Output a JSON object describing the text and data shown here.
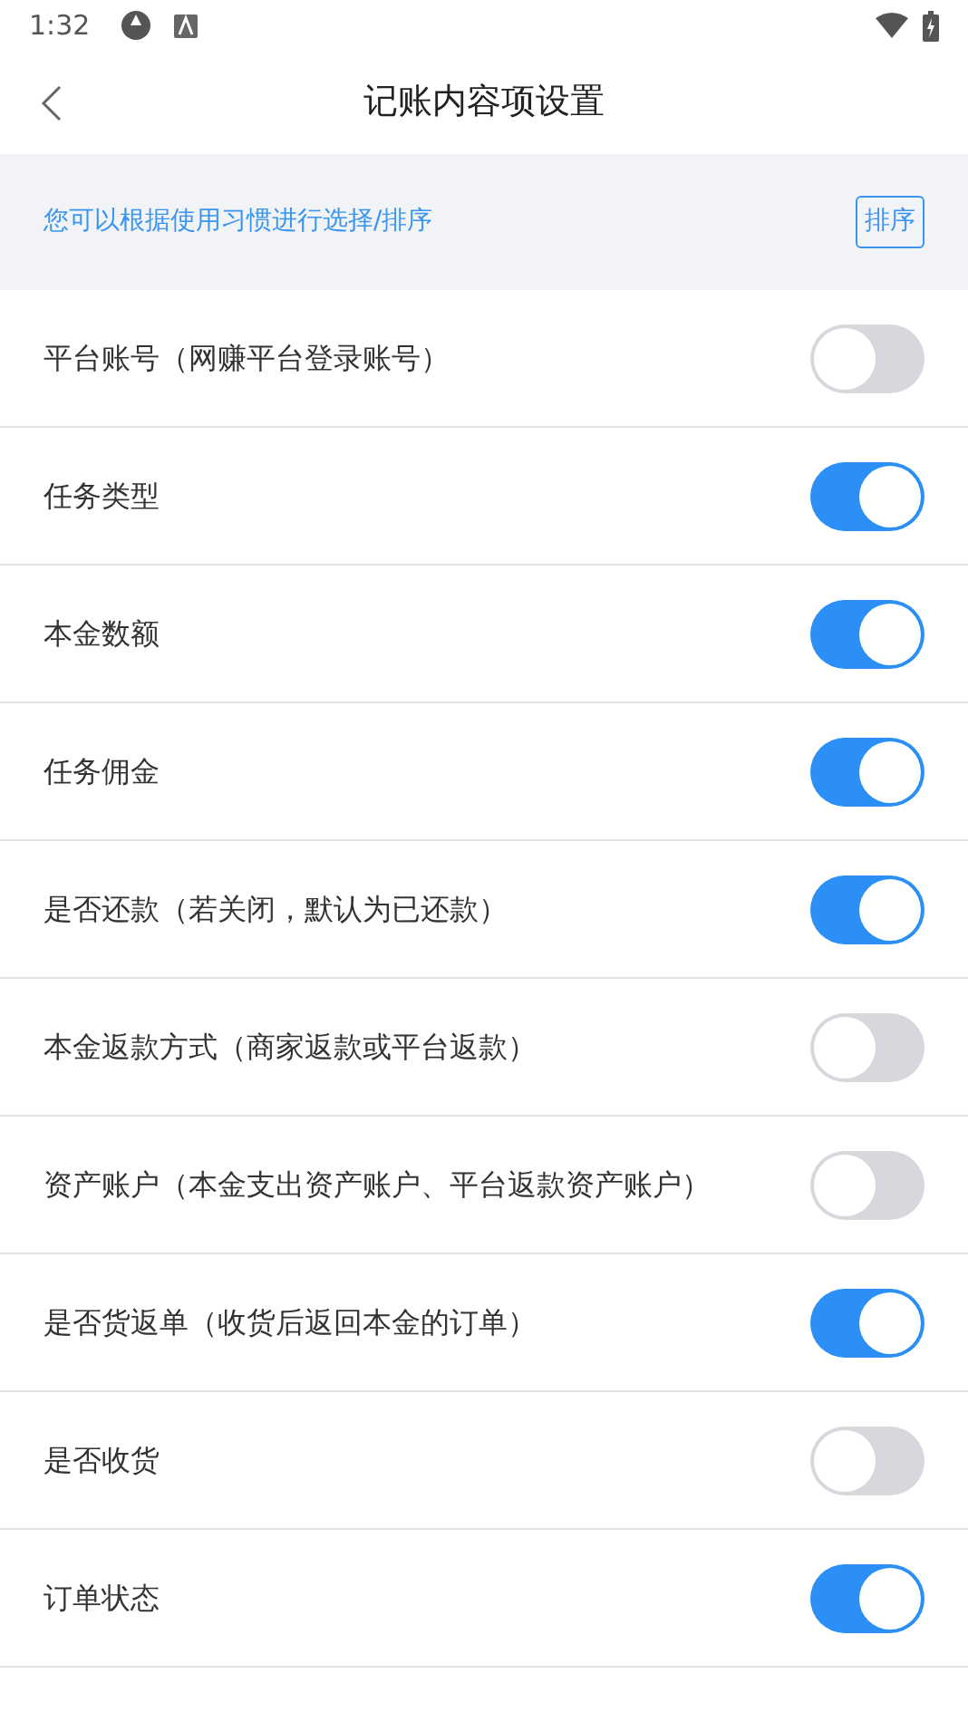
{
  "status_bar": {
    "time": "1:32"
  },
  "header": {
    "title": "记账内容项设置"
  },
  "banner": {
    "text": "您可以根据使用习惯进行选择/排序",
    "button": "排序"
  },
  "items": [
    {
      "label": "平台账号（网赚平台登录账号）",
      "on": false
    },
    {
      "label": "任务类型",
      "on": true
    },
    {
      "label": "本金数额",
      "on": true
    },
    {
      "label": "任务佣金",
      "on": true
    },
    {
      "label": "是否还款（若关闭，默认为已还款）",
      "on": true
    },
    {
      "label": "本金返款方式（商家返款或平台返款）",
      "on": false
    },
    {
      "label": "资产账户（本金支出资产账户、平台返款资产账户）",
      "on": false
    },
    {
      "label": "是否货返单（收货后返回本金的订单）",
      "on": true
    },
    {
      "label": "是否收货",
      "on": false
    },
    {
      "label": "订单状态",
      "on": true
    }
  ]
}
